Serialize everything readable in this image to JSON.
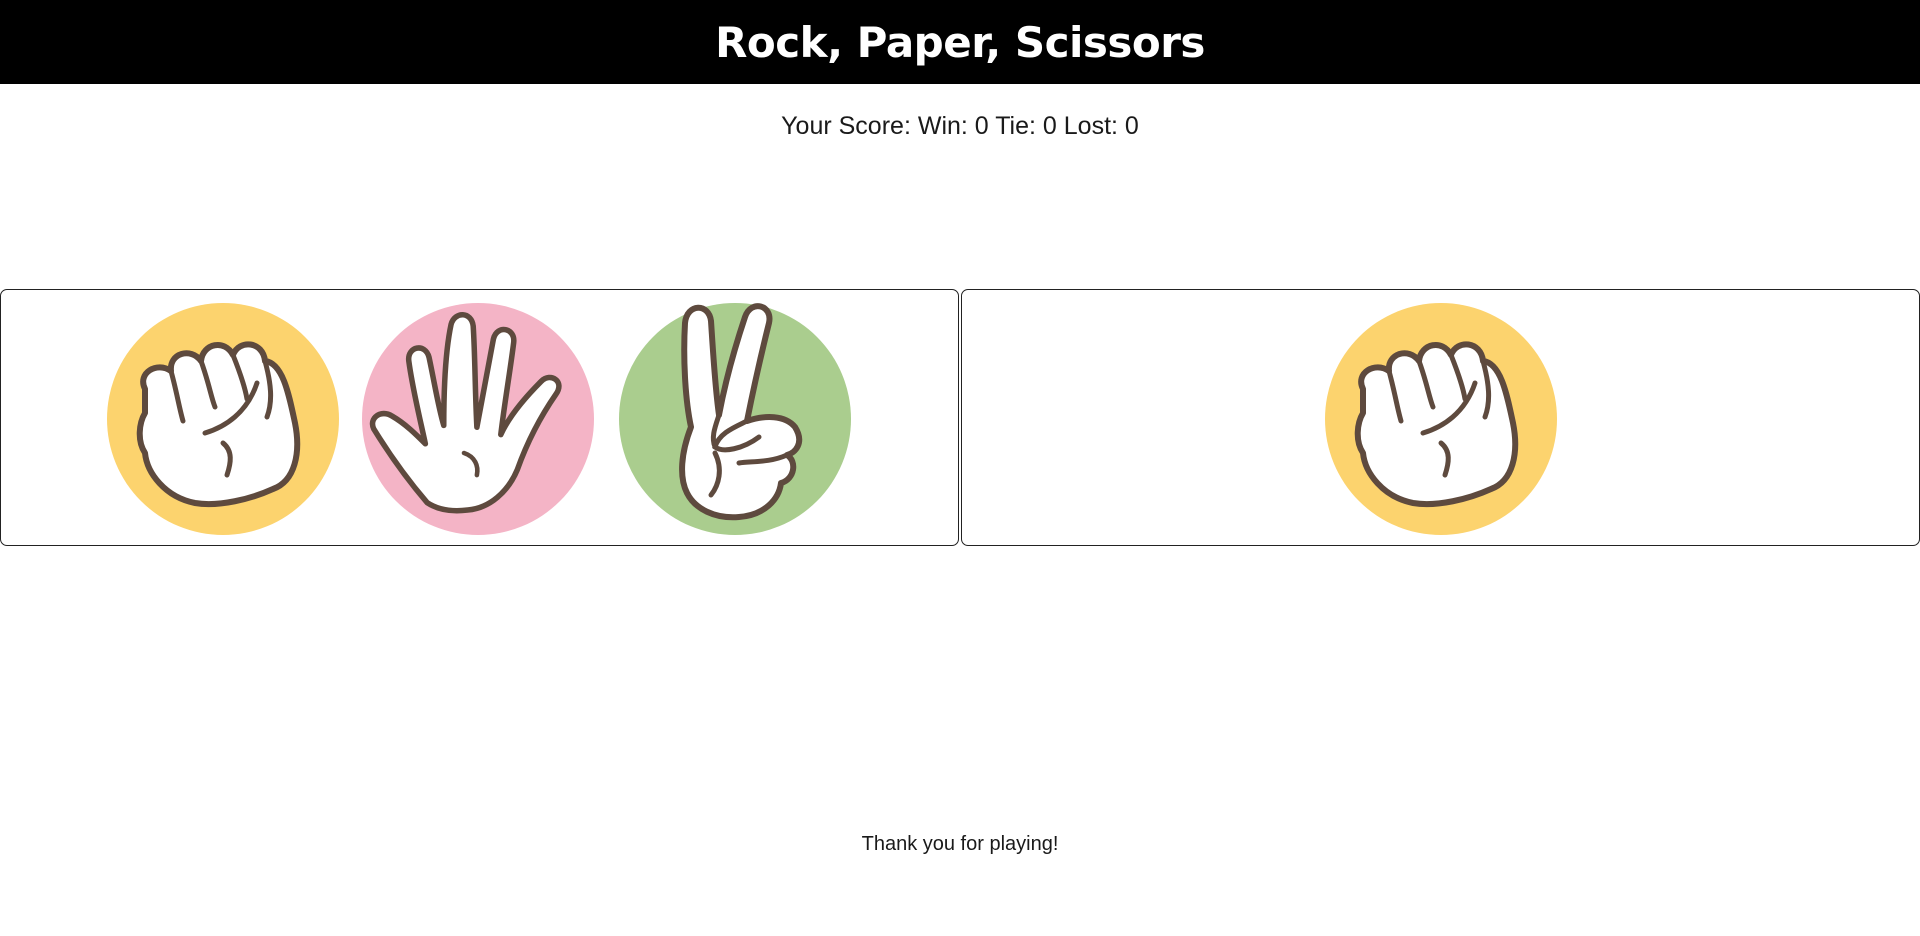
{
  "header": {
    "title": "Rock, Paper, Scissors"
  },
  "score": {
    "prefix": "Your Score:",
    "win_label": "Win:",
    "win": "0",
    "tie_label": "Tie:",
    "tie": "0",
    "lost_label": "Lost:",
    "lost": "0"
  },
  "player": {
    "choices": [
      {
        "name": "rock",
        "icon": "rock-hand-icon",
        "color": "#fcd36e"
      },
      {
        "name": "paper",
        "icon": "paper-hand-icon",
        "color": "#f4b4c6"
      },
      {
        "name": "scissors",
        "icon": "scissors-hand-icon",
        "color": "#aacd8e"
      }
    ]
  },
  "computer": {
    "choice": "rock",
    "icon": "rock-hand-icon",
    "color": "#fcd36e"
  },
  "footer": {
    "message": "Thank you for playing!"
  }
}
